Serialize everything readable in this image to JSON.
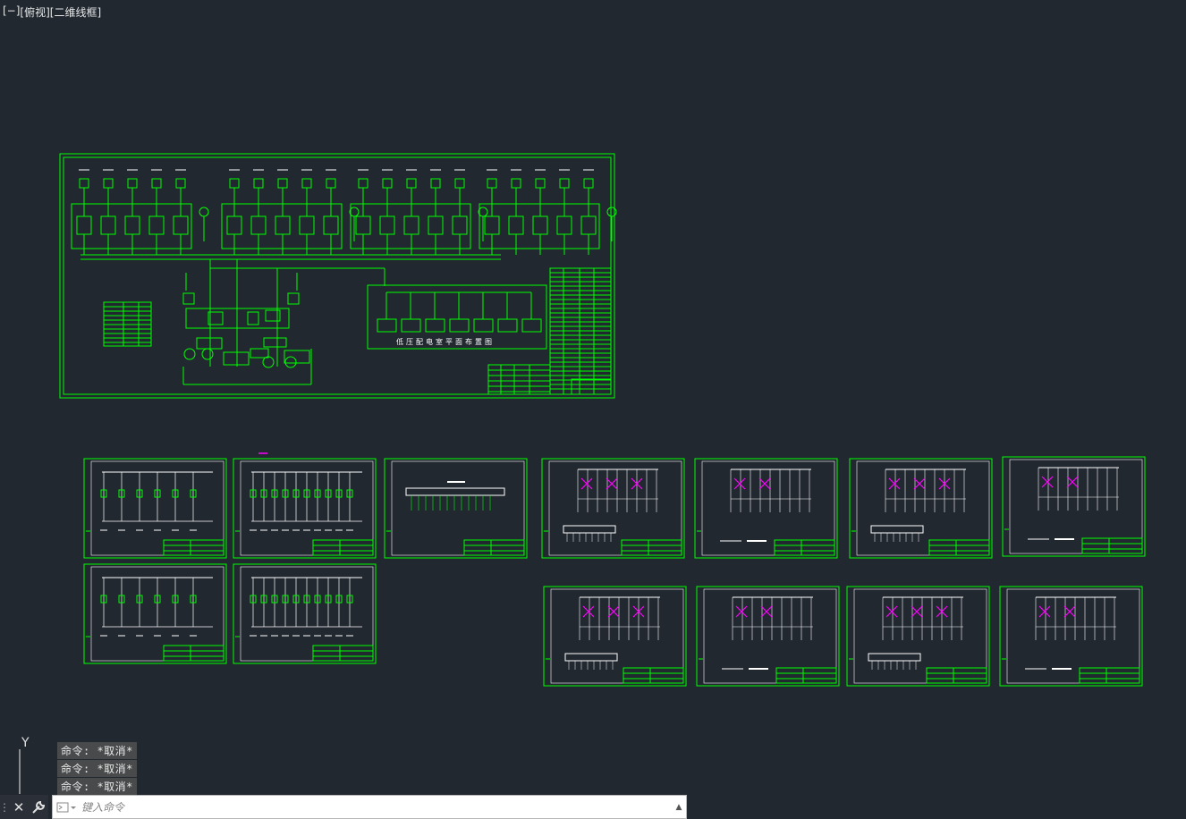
{
  "viewport": {
    "minus": "[−]",
    "view": "[俯视]",
    "style": "[二维线框]"
  },
  "main_sheet_caption": "低压配电室平面布置图",
  "command_history": [
    "命令: *取消*",
    "命令: *取消*",
    "命令: *取消*"
  ],
  "command_line": {
    "placeholder": "键入命令",
    "close_icon": "✕",
    "customize_icon": "wrench"
  },
  "ucs": {
    "y_label": "Y"
  },
  "colors": {
    "background": "#212830",
    "line": "#00ff00",
    "white": "#ffffff",
    "magenta": "#ff00ff"
  }
}
